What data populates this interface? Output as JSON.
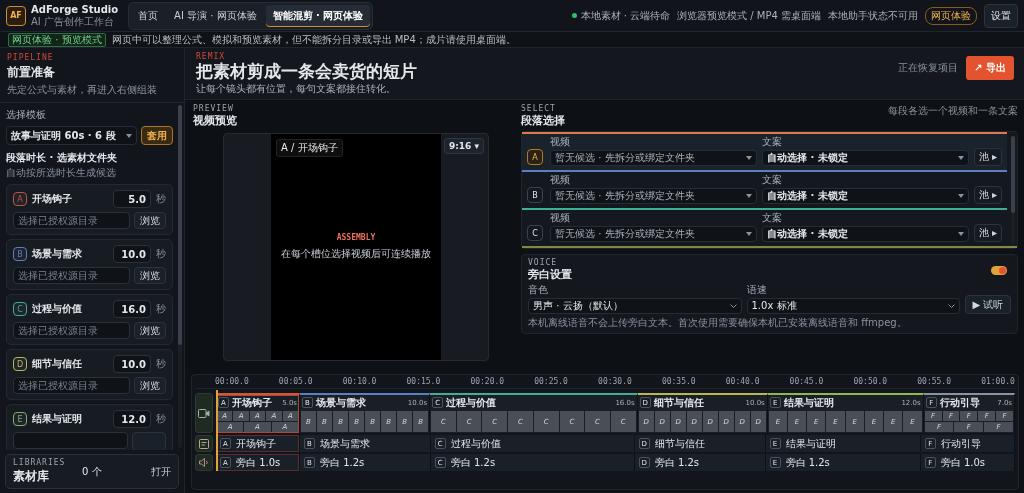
{
  "app": {
    "logo": "AF",
    "name": "AdForge Studio",
    "tagline": "AI 广告创作工作台"
  },
  "nav_tabs": [
    {
      "label": "首页",
      "selected": false
    },
    {
      "label": "AI 导演 · 网页体验",
      "selected": false
    },
    {
      "label": "智能混剪 · 网页体验",
      "selected": true
    }
  ],
  "status": {
    "storage": "本地素材 · 云端待命",
    "mode": "浏览器预览模式 / MP4 需桌面端",
    "helper": "本地助手状态不可用",
    "badge": "网页体验",
    "settings": "设置"
  },
  "notice": {
    "badge": "网页体验 · 预览模式",
    "text": "网页中可以整理公式、模拟和预览素材，但不能拆分目录或导出 MP4；成片请使用桌面端。"
  },
  "sidebar": {
    "eyebrow": "PIPELINE",
    "title": "前置准备",
    "subtitle": "先定公式与素材，再进入右侧组装",
    "template_label": "选择模板",
    "template_value": "故事与证明 60s · 6 段",
    "apply": "套用",
    "segments_title": "段落时长 · 选素材文件夹",
    "segments_hint": "自动按所选时长生成候选",
    "segments": [
      {
        "letter": "A",
        "name": "开场钩子",
        "seconds": "5.0",
        "unit": "秒",
        "color": "#c2553a",
        "placeholder": "选择已授权源目录",
        "browse": "浏览"
      },
      {
        "letter": "B",
        "name": "场景与需求",
        "seconds": "10.0",
        "unit": "秒",
        "color": "#5b7fc0",
        "placeholder": "选择已授权源目录",
        "browse": "浏览"
      },
      {
        "letter": "C",
        "name": "过程与价值",
        "seconds": "16.0",
        "unit": "秒",
        "color": "#3fae96",
        "placeholder": "选择已授权源目录",
        "browse": "浏览"
      },
      {
        "letter": "D",
        "name": "细节与信任",
        "seconds": "10.0",
        "unit": "秒",
        "color": "#b7b84f",
        "placeholder": "选择已授权源目录",
        "browse": "浏览"
      },
      {
        "letter": "E",
        "name": "结果与证明",
        "seconds": "12.0",
        "unit": "秒",
        "color": "#7fb069"
      }
    ],
    "libraries": {
      "eyebrow": "LIBRARIES",
      "title": "素材库",
      "count": "0 个",
      "open": "打开"
    }
  },
  "header": {
    "eyebrow": "REMIX",
    "title": "把素材剪成一条会卖货的短片",
    "subtitle": "让每个镜头都有位置，每句文案都接住转化。",
    "status": "正在恢复项目",
    "export": "↗ 导出"
  },
  "preview": {
    "eyebrow": "PREVIEW",
    "title": "视频预览",
    "tag": "A / 开场钩子",
    "ratio": "9:16 ▾",
    "overlay_title": "ASSEMBLY",
    "overlay_text": "在每个槽位选择视频后可连续播放"
  },
  "select": {
    "eyebrow": "SELECT",
    "title": "段落选择",
    "hint": "每段各选一个视频和一条文案",
    "rows": [
      {
        "letter": "A",
        "color": "#e0774f",
        "selected": true,
        "video_label": "视频",
        "video": "暂无候选 · 先拆分或绑定文件夹",
        "copy_label": "文案",
        "copy": "自动选择 · 未锁定",
        "pool": "池 ▸"
      },
      {
        "letter": "B",
        "color": "#5b7fc0",
        "selected": false,
        "video_label": "视频",
        "video": "暂无候选 · 先拆分或绑定文件夹",
        "copy_label": "文案",
        "copy": "自动选择 · 未锁定",
        "pool": "池 ▸"
      },
      {
        "letter": "C",
        "color": "#3fae96",
        "selected": false,
        "video_label": "视频",
        "video": "暂无候选 · 先拆分或绑定文件夹",
        "copy_label": "文案",
        "copy": "自动选择 · 未锁定",
        "pool": "池 ▸"
      }
    ]
  },
  "voice": {
    "eyebrow": "VOICE",
    "title": "旁白设置",
    "on": true,
    "timbre_label": "音色",
    "timbre": "男声 · 云扬（默认）",
    "speed_label": "语速",
    "speed": "1.0x 标准",
    "listen": "▶ 试听",
    "note": "本机离线语音不会上传旁白文本。首次使用需要确保本机已安装离线语音和 ffmpeg。"
  },
  "timeline": {
    "ticks": [
      "00:00.0",
      "00:05.0",
      "00:10.0",
      "00:15.0",
      "00:20.0",
      "00:25.0",
      "00:30.0",
      "00:35.0",
      "00:40.0",
      "00:45.0",
      "00:50.0",
      "00:55.0",
      "01:00.0"
    ],
    "clips": [
      {
        "letter": "A",
        "name": "开场钩子",
        "duration": "5.0s",
        "color": "#d0583a",
        "selected": true,
        "thumbs": [
          "A",
          "A",
          "A",
          "A",
          "A",
          "A",
          "A",
          "A"
        ],
        "caption_letter": "A",
        "caption": "开场钩子",
        "voice_letter": "A",
        "voice": "旁白 1.0s"
      },
      {
        "letter": "B",
        "name": "场景与需求",
        "duration": "10.0s",
        "color": "#5b7fc0",
        "selected": false,
        "thumbs": [
          "B",
          "B",
          "B",
          "B",
          "B",
          "B",
          "B",
          "B"
        ],
        "caption_letter": "B",
        "caption": "场景与需求",
        "voice_letter": "B",
        "voice": "旁白 1.2s"
      },
      {
        "letter": "C",
        "name": "过程与价值",
        "duration": "16.0s",
        "color": "#3fae96",
        "selected": false,
        "thumbs": [
          "C",
          "C",
          "C",
          "C",
          "C",
          "C",
          "C",
          "C"
        ],
        "caption_letter": "C",
        "caption": "过程与价值",
        "voice_letter": "C",
        "voice": "旁白 1.2s"
      },
      {
        "letter": "D",
        "name": "细节与信任",
        "duration": "10.0s",
        "color": "#b7b84f",
        "selected": false,
        "thumbs": [
          "D",
          "D",
          "D",
          "D",
          "D",
          "D",
          "D",
          "D"
        ],
        "caption_letter": "D",
        "caption": "细节与信任",
        "voice_letter": "D",
        "voice": "旁白 1.2s"
      },
      {
        "letter": "E",
        "name": "结果与证明",
        "duration": "12.0s",
        "color": "#8fb84f",
        "selected": false,
        "thumbs": [
          "E",
          "E",
          "E",
          "E",
          "E",
          "E",
          "E",
          "E"
        ],
        "caption_letter": "E",
        "caption": "结果与证明",
        "voice_letter": "E",
        "voice": "旁白 1.2s"
      },
      {
        "letter": "F",
        "name": "行动引导",
        "duration": "7.0s",
        "color": "#8a93a6",
        "selected": false,
        "thumbs": [
          "F",
          "F",
          "F",
          "F",
          "F",
          "F",
          "F",
          "F"
        ],
        "caption_letter": "F",
        "caption": "行动引导",
        "voice_letter": "F",
        "voice": "旁白 1.0s"
      }
    ]
  }
}
